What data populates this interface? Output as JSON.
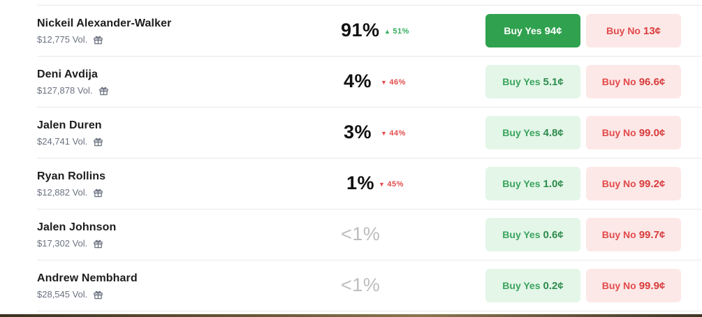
{
  "rows": [
    {
      "name": "Nickeil Alexander-Walker",
      "volume": "$12,775 Vol.",
      "chance": "91%",
      "muted": false,
      "change": {
        "dir": "up",
        "arrow": "▲",
        "value": "51%"
      },
      "yes": {
        "label": "Buy Yes",
        "price": "94¢",
        "active": true
      },
      "no": {
        "label": "Buy No",
        "price": "13¢"
      }
    },
    {
      "name": "Deni Avdija",
      "volume": "$127,878 Vol.",
      "chance": "4%",
      "muted": false,
      "change": {
        "dir": "down",
        "arrow": "▼",
        "value": "46%"
      },
      "yes": {
        "label": "Buy Yes",
        "price": "5.1¢",
        "active": false
      },
      "no": {
        "label": "Buy No",
        "price": "96.6¢"
      }
    },
    {
      "name": "Jalen Duren",
      "volume": "$24,741 Vol.",
      "chance": "3%",
      "muted": false,
      "change": {
        "dir": "down",
        "arrow": "▼",
        "value": "44%"
      },
      "yes": {
        "label": "Buy Yes",
        "price": "4.8¢",
        "active": false
      },
      "no": {
        "label": "Buy No",
        "price": "99.0¢"
      }
    },
    {
      "name": "Ryan Rollins",
      "volume": "$12,882 Vol.",
      "chance": "1%",
      "muted": false,
      "change": {
        "dir": "down",
        "arrow": "▼",
        "value": "45%"
      },
      "yes": {
        "label": "Buy Yes",
        "price": "1.0¢",
        "active": false
      },
      "no": {
        "label": "Buy No",
        "price": "99.2¢"
      }
    },
    {
      "name": "Jalen Johnson",
      "volume": "$17,302 Vol.",
      "chance": "<1%",
      "muted": true,
      "change": null,
      "yes": {
        "label": "Buy Yes",
        "price": "0.6¢",
        "active": false
      },
      "no": {
        "label": "Buy No",
        "price": "99.7¢"
      }
    },
    {
      "name": "Andrew Nembhard",
      "volume": "$28,545 Vol.",
      "chance": "<1%",
      "muted": true,
      "change": null,
      "yes": {
        "label": "Buy Yes",
        "price": "0.2¢",
        "active": false
      },
      "no": {
        "label": "Buy No",
        "price": "99.9¢"
      }
    }
  ],
  "icons": {
    "volume_gift": "gift-icon"
  },
  "colors": {
    "yes_active_bg": "#30a14e",
    "yes_bg": "#e3f6e8",
    "no_bg": "#fde8e8",
    "up": "#2fae5a",
    "down": "#e24b4b"
  }
}
